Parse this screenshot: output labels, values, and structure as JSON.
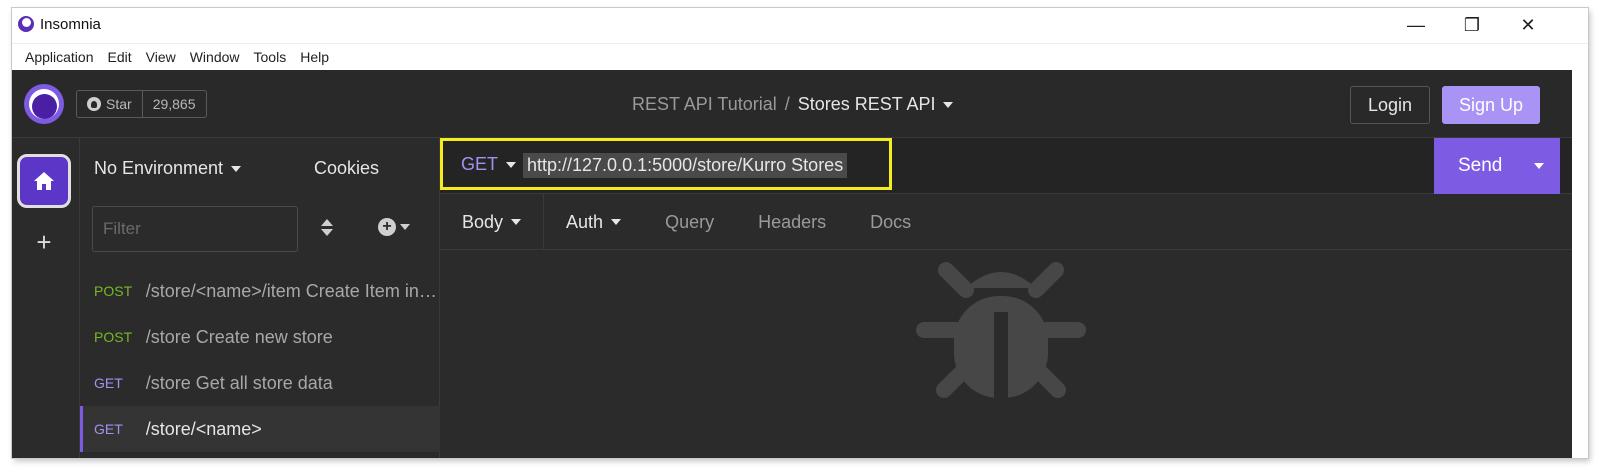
{
  "window": {
    "title": "Insomnia",
    "minimize_glyph": "—",
    "maximize_glyph": "❐",
    "close_glyph": "✕"
  },
  "menu": [
    "Application",
    "Edit",
    "View",
    "Window",
    "Tools",
    "Help"
  ],
  "header": {
    "star_label": "Star",
    "star_count": "29,865",
    "project": "REST API Tutorial",
    "separator": "/",
    "collection": "Stores REST API",
    "login_label": "Login",
    "signup_label": "Sign Up"
  },
  "rail": {
    "add_glyph": "+"
  },
  "sidebar": {
    "environment": "No Environment",
    "cookies": "Cookies",
    "filter_placeholder": "Filter",
    "add_glyph": "+",
    "requests": [
      {
        "method": "POST",
        "name": "/store/<name>/item Create Item in a store"
      },
      {
        "method": "POST",
        "name": "/store Create new store"
      },
      {
        "method": "GET",
        "name": "/store Get all store data"
      },
      {
        "method": "GET",
        "name": "/store/<name>"
      }
    ]
  },
  "request": {
    "method": "GET",
    "url": "http://127.0.0.1:5000/store/Kurro Stores",
    "send_label": "Send"
  },
  "tabs": [
    "Body",
    "Auth",
    "Query",
    "Headers",
    "Docs"
  ],
  "colors": {
    "accent": "#7d5be3",
    "post": "#75ba24",
    "get": "#a590f0",
    "highlight": "#f5ec1e"
  }
}
